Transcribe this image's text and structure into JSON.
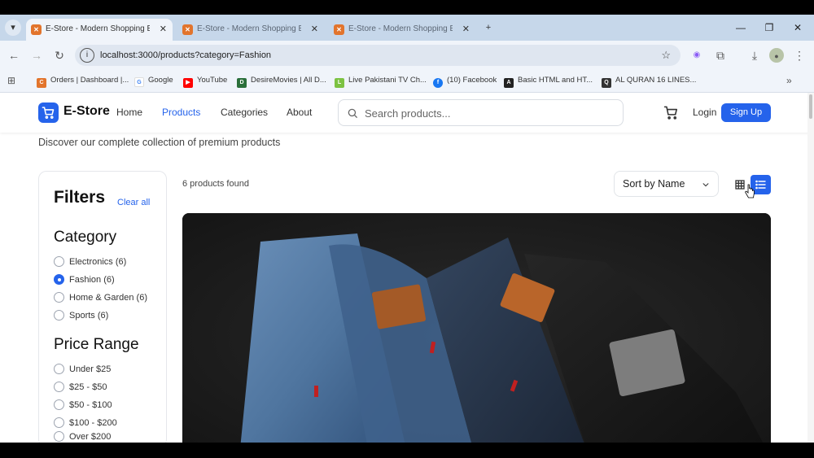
{
  "browser": {
    "tabs": [
      {
        "title": "E-Store - Modern Shopping Exp",
        "active": true
      },
      {
        "title": "E-Store - Modern Shopping Exp",
        "active": false
      },
      {
        "title": "E-Store - Modern Shopping Exp",
        "active": false
      }
    ],
    "url": "localhost:3000/products?category=Fashion",
    "bookmarks": [
      {
        "label": "Orders | Dashboard |...",
        "icon": "orders-icon",
        "color": "#e2742c"
      },
      {
        "label": "Google",
        "icon": "google-icon",
        "color": "#4285f4"
      },
      {
        "label": "YouTube",
        "icon": "youtube-icon",
        "color": "#ff0000"
      },
      {
        "label": "DesireMovies | All D...",
        "icon": "desiremovies-icon",
        "color": "#2a6f3a"
      },
      {
        "label": "Live Pakistani TV Ch...",
        "icon": "live-tv-icon",
        "color": "#7cc242"
      },
      {
        "label": "(10) Facebook",
        "icon": "facebook-icon",
        "color": "#1877f2"
      },
      {
        "label": "Basic HTML and HT...",
        "icon": "html-icon",
        "color": "#222222"
      },
      {
        "label": "AL QURAN 16 LINES...",
        "icon": "quran-icon",
        "color": "#333333"
      }
    ]
  },
  "header": {
    "brand": "E-Store",
    "nav": [
      {
        "label": "Home",
        "active": false
      },
      {
        "label": "Products",
        "active": true
      },
      {
        "label": "Categories",
        "active": false
      },
      {
        "label": "About",
        "active": false
      }
    ],
    "search_placeholder": "Search products...",
    "login_label": "Login",
    "signup_label": "Sign Up"
  },
  "main": {
    "subtitle": "Discover our complete collection of premium products",
    "results_count": "6 products found",
    "sort_label": "Sort by Name"
  },
  "filters": {
    "title": "Filters",
    "clear_all": "Clear all",
    "category_heading": "Category",
    "categories": [
      {
        "label": "Electronics (6)",
        "checked": false
      },
      {
        "label": "Fashion (6)",
        "checked": true
      },
      {
        "label": "Home & Garden (6)",
        "checked": false
      },
      {
        "label": "Sports (6)",
        "checked": false
      }
    ],
    "price_heading": "Price Range",
    "prices": [
      {
        "label": "Under $25",
        "checked": false
      },
      {
        "label": "$25 - $50",
        "checked": false
      },
      {
        "label": "$50 - $100",
        "checked": false
      },
      {
        "label": "$100 - $200",
        "checked": false
      },
      {
        "label": "Over $200",
        "checked": false
      }
    ]
  },
  "colors": {
    "accent": "#2563eb"
  }
}
